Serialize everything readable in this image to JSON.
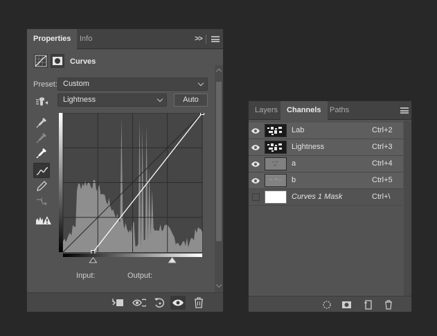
{
  "properties_panel": {
    "tabs": [
      {
        "label": "Properties",
        "active": true
      },
      {
        "label": "Info",
        "active": false
      }
    ],
    "collapse_label": ">>",
    "adjustment_title": "Curves",
    "preset_label": "Preset:",
    "preset_value": "Custom",
    "channel_value": "Lightness",
    "auto_label": "Auto",
    "tools": [
      "target-adjust-icon",
      "eyedropper-black-icon",
      "eyedropper-gray-icon",
      "eyedropper-white-icon",
      "curve-points-icon",
      "pencil-draw-icon",
      "smooth-curve-icon",
      "clipping-warning-icon"
    ],
    "input_label": "Input:",
    "output_label": "Output:",
    "curve": {
      "black_point": {
        "input": 55,
        "output": 0
      },
      "white_point": {
        "input": 255,
        "output": 255
      }
    },
    "footer_buttons": [
      "clip-to-layer-icon",
      "view-previous-icon",
      "reset-icon",
      "visibility-eye-icon",
      "trash-icon"
    ]
  },
  "channels_panel": {
    "tabs": [
      {
        "label": "Layers",
        "active": false
      },
      {
        "label": "Channels",
        "active": true
      },
      {
        "label": "Paths",
        "active": false
      }
    ],
    "channels": [
      {
        "name": "Lab",
        "shortcut": "Ctrl+2",
        "visible": true
      },
      {
        "name": "Lightness",
        "shortcut": "Ctrl+3",
        "visible": true
      },
      {
        "name": "a",
        "shortcut": "Ctrl+4",
        "visible": true
      },
      {
        "name": "b",
        "shortcut": "Ctrl+5",
        "visible": true
      },
      {
        "name": "Curves 1 Mask",
        "shortcut": "Ctrl+\\",
        "visible": false
      }
    ],
    "footer_buttons": [
      "load-selection-icon",
      "save-selection-icon",
      "new-channel-icon",
      "delete-channel-icon"
    ]
  }
}
